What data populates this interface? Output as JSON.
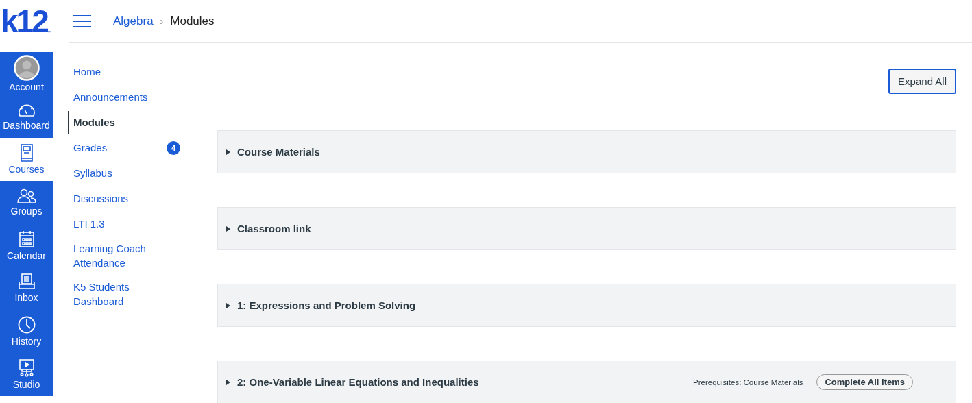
{
  "logo": {
    "text": "k12",
    "mark": "™"
  },
  "global_nav": [
    {
      "kind": "account",
      "label": "Account",
      "selected": false
    },
    {
      "kind": "dashboard",
      "label": "Dashboard",
      "selected": false
    },
    {
      "kind": "courses",
      "label": "Courses",
      "selected": true
    },
    {
      "kind": "groups",
      "label": "Groups",
      "selected": false
    },
    {
      "kind": "calendar",
      "label": "Calendar",
      "selected": false
    },
    {
      "kind": "inbox",
      "label": "Inbox",
      "selected": false
    },
    {
      "kind": "history",
      "label": "History",
      "selected": false
    },
    {
      "kind": "studio",
      "label": "Studio",
      "selected": false
    }
  ],
  "breadcrumb": {
    "parent": "Algebra",
    "separator": "›",
    "current": "Modules"
  },
  "course_nav": [
    {
      "label": "Home",
      "selected": false
    },
    {
      "label": "Announcements",
      "selected": false
    },
    {
      "label": "Modules",
      "selected": true
    },
    {
      "label": "Grades",
      "selected": false,
      "badge": "4"
    },
    {
      "label": "Syllabus",
      "selected": false
    },
    {
      "label": "Discussions",
      "selected": false
    },
    {
      "label": "LTI 1.3",
      "selected": false
    },
    {
      "label": "Learning Coach Attendance",
      "selected": false
    },
    {
      "label": "K5 Students Dashboard",
      "selected": false
    }
  ],
  "expand_all": "Expand All",
  "modules": [
    {
      "title": "Course Materials",
      "expanded": false
    },
    {
      "title": "Classroom link",
      "expanded": false
    },
    {
      "title": "1: Expressions and Problem Solving",
      "expanded": false
    },
    {
      "title": "2: One-Variable Linear Equations and Inequalities",
      "expanded": false,
      "prerequisites": "Prerequisites: Course Materials",
      "action": "Complete All Items"
    }
  ]
}
